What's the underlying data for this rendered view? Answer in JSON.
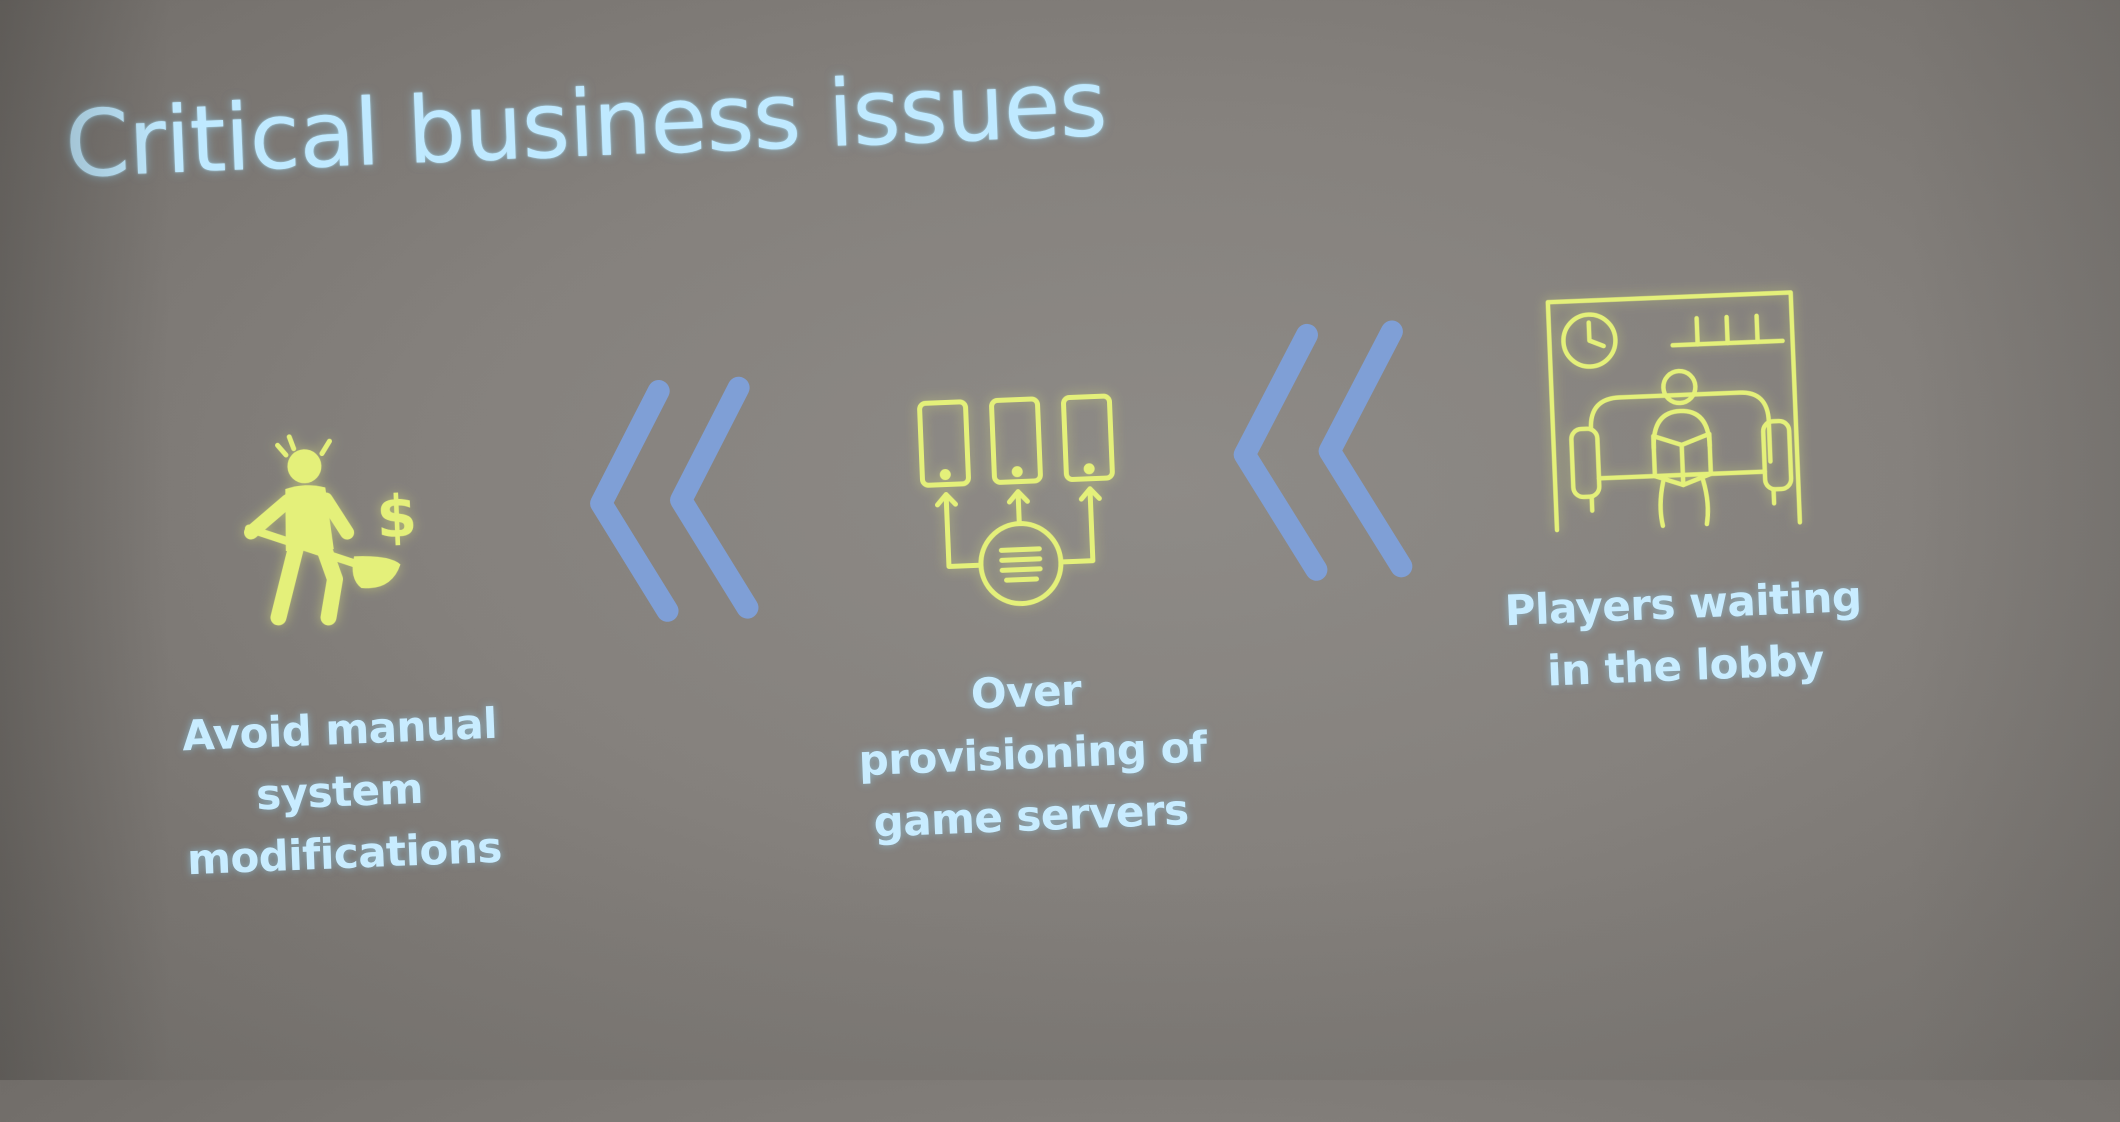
{
  "slide": {
    "title": "Critical business issues",
    "items": [
      {
        "icon": "person-shoveling-money-icon",
        "label_lines": [
          "Avoid manual",
          "system",
          "modifications"
        ]
      },
      {
        "icon": "game-servers-provisioning-icon",
        "label_lines": [
          "Over",
          "provisioning of",
          "game servers"
        ]
      },
      {
        "icon": "player-waiting-lobby-icon",
        "label_lines": [
          "Players waiting",
          "in the lobby"
        ]
      }
    ],
    "arrows": [
      "double-chevron-left-icon",
      "double-chevron-left-icon"
    ]
  },
  "colors": {
    "title": "#bfe9ff",
    "label": "#c8ecff",
    "icon": "#e4f07a",
    "chevron": "#7f9fd6",
    "background": "#8a8783"
  }
}
